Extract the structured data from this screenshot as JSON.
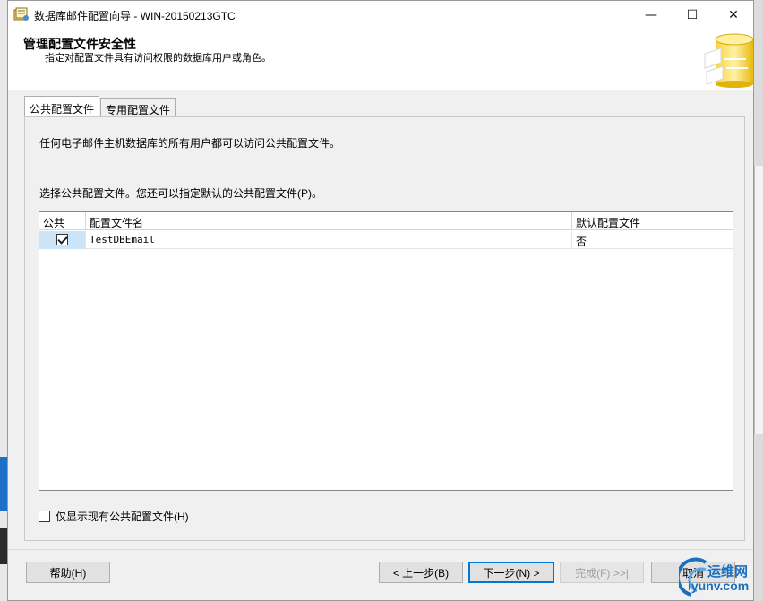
{
  "window": {
    "title": "数据库邮件配置向导 - WIN-20150213GTC",
    "minimize_glyph": "—",
    "maximize_glyph": "☐",
    "close_glyph": "✕"
  },
  "header": {
    "title": "管理配置文件安全性",
    "subtitle": "指定对配置文件具有访问权限的数据库用户或角色。"
  },
  "tabs": [
    {
      "label": "公共配置文件",
      "active": true
    },
    {
      "label": "专用配置文件",
      "active": false
    }
  ],
  "panel": {
    "intro": "任何电子邮件主机数据库的所有用户都可以访问公共配置文件。",
    "instruction": "选择公共配置文件。您还可以指定默认的公共配置文件(P)。"
  },
  "grid": {
    "columns": [
      "公共",
      "配置文件名",
      "默认配置文件"
    ],
    "rows": [
      {
        "public": true,
        "profile_name": "TestDBEmail",
        "default": "否"
      }
    ]
  },
  "options": {
    "only_public_label": "仅显示现有公共配置文件(H)",
    "only_public_checked": false
  },
  "buttons": {
    "help": "帮助(H)",
    "back": "< 上一步(B)",
    "next": "下一步(N) >",
    "finish": "完成(F) >>|",
    "cancel": "取消"
  },
  "watermark": {
    "line1": "运维网",
    "line2": "iyunv.com"
  },
  "colors": {
    "selection": "#cce4f7",
    "default_button_border": "#0078d7",
    "watermark_blue": "#1b6fbf"
  }
}
